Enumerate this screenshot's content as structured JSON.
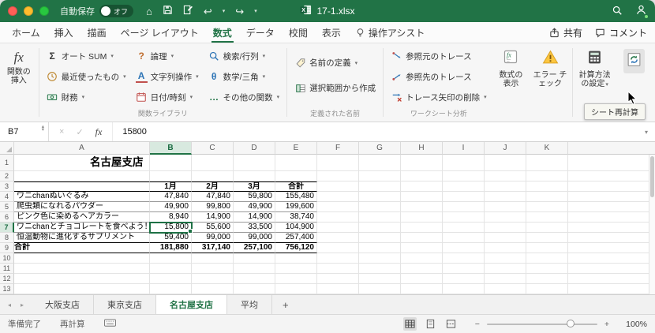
{
  "colors": {
    "accent": "#217346",
    "selection": "#1e7145",
    "titlebar_green": "#217346",
    "header_highlight": "#d8e9df"
  },
  "icons": {
    "sigma": "Σ",
    "question": "?",
    "text_a": "A",
    "theta": "θ",
    "ellipsis": "…",
    "fx": "fx",
    "chevron_down": "▾",
    "chevron_up": "▴",
    "cancel": "×",
    "check": "✓",
    "undo": "↩",
    "redo": "↪",
    "home": "⌂",
    "plus": "+",
    "minus": "−",
    "left_arrow": "◂",
    "right_arrow": "▸"
  },
  "titlebar": {
    "autosave_label": "自動保存",
    "autosave_state": "オフ",
    "filename": "17-1.xlsx"
  },
  "tabs": {
    "items": [
      {
        "label": "ホーム"
      },
      {
        "label": "挿入"
      },
      {
        "label": "描画"
      },
      {
        "label": "ページ レイアウト"
      },
      {
        "label": "数式",
        "active": true
      },
      {
        "label": "データ"
      },
      {
        "label": "校閲"
      },
      {
        "label": "表示"
      },
      {
        "label": "操作アシスト"
      }
    ],
    "share": "共有",
    "comments": "コメント"
  },
  "ribbon": {
    "insert_function": "関数の挿入",
    "groups": {
      "function_library": {
        "title": "関数ライブラリ",
        "items": [
          {
            "label": "オート SUM",
            "icon": "sigma-icon"
          },
          {
            "label": "最近使ったもの",
            "icon": "clock-icon"
          },
          {
            "label": "財務",
            "icon": "money-icon"
          },
          {
            "label": "論理",
            "icon": "question-icon"
          },
          {
            "label": "文字列操作",
            "icon": "text-icon"
          },
          {
            "label": "日付/時刻",
            "icon": "calendar-icon"
          },
          {
            "label": "検索/行列",
            "icon": "search-icon"
          },
          {
            "label": "数学/三角",
            "icon": "theta-icon"
          },
          {
            "label": "その他の関数",
            "icon": "more-functions-icon"
          }
        ]
      },
      "defined_names": {
        "title": "定義された名前",
        "items": [
          {
            "label": "名前の定義",
            "icon": "tag-icon"
          },
          {
            "label": "選択範囲から作成",
            "icon": "create-from-selection-icon"
          }
        ]
      },
      "worksheet_analysis": {
        "title": "ワークシート分析",
        "items": [
          {
            "label": "参照元のトレース",
            "icon": "trace-precedents-icon"
          },
          {
            "label": "参照先のトレース",
            "icon": "trace-dependents-icon"
          },
          {
            "label": "トレース矢印の削除",
            "icon": "remove-arrows-icon"
          }
        ]
      }
    },
    "show_formulas": "数式の表示",
    "error_check": "エラー チェック",
    "calc_options": "計算方法の設定",
    "tooltip": "シート再計算"
  },
  "formula_bar": {
    "name_box": "B7",
    "value": "15800"
  },
  "sheet": {
    "columns": [
      "A",
      "B",
      "C",
      "D",
      "E",
      "F",
      "G",
      "H",
      "I",
      "J",
      "K"
    ],
    "row_count": 13,
    "selection": {
      "col": "B",
      "row": 7
    },
    "cells": {
      "A1": "名古屋支店",
      "B3": "1月",
      "C3": "2月",
      "D3": "3月",
      "E3": "合計",
      "A4": "ワニchanぬいぐるみ",
      "B4": "47,840",
      "C4": "47,840",
      "D4": "59,800",
      "E4": "155,480",
      "A5": "爬虫類になれるパウダー",
      "B5": "49,900",
      "C5": "99,800",
      "D5": "49,900",
      "E5": "199,600",
      "A6": "ピンク色に染めるヘアカラー",
      "B6": "8,940",
      "C6": "14,900",
      "D6": "14,900",
      "E6": "38,740",
      "A7": "ワニchanとチョコレートを食べよう！",
      "B7": "15,800",
      "C7": "55,600",
      "D7": "33,500",
      "E7": "104,900",
      "A8": "恒温動物に進化するサプリメント",
      "B8": "59,400",
      "C8": "99,000",
      "D8": "99,000",
      "E8": "257,400",
      "A9": "合計",
      "B9": "181,880",
      "C9": "317,140",
      "D9": "257,100",
      "E9": "756,120"
    }
  },
  "sheet_tabs": {
    "items": [
      {
        "label": "大阪支店"
      },
      {
        "label": "東京支店"
      },
      {
        "label": "名古屋支店",
        "active": true
      },
      {
        "label": "平均"
      }
    ]
  },
  "status_bar": {
    "ready": "準備完了",
    "calc": "再計算",
    "zoom": "100%"
  }
}
